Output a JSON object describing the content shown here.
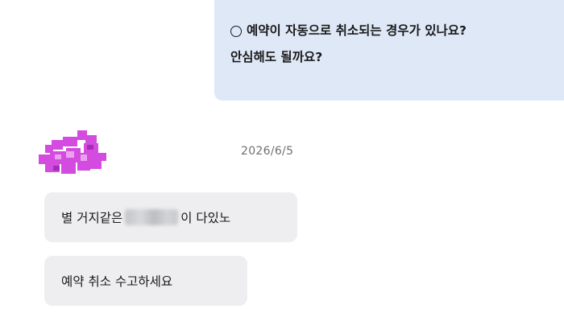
{
  "question": {
    "line1": "예약이 자동으로 취소되는 경우가 있나요?",
    "line2": "안심해도 될까요?"
  },
  "conversation": {
    "date": "2026/6/5",
    "avatar_icon": "pixelated-avatar-icon",
    "avatar_color": "#d44bdf",
    "replies": [
      {
        "before": "별 거지같은",
        "after": "이 다있노"
      },
      {
        "text": "예약 취소 수고하세요"
      }
    ]
  },
  "colors": {
    "question_bubble": "#dfe8f7",
    "reply_bubble": "#eeeef0"
  }
}
